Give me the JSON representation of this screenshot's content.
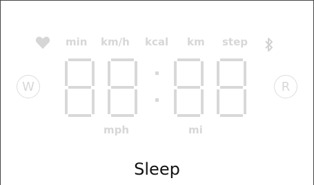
{
  "indicators": {
    "units_top": [
      "min",
      "km/h",
      "kcal",
      "km",
      "step"
    ],
    "units_bottom": [
      "mph",
      "mi"
    ],
    "left_button_label": "W",
    "right_button_label": "R"
  },
  "display": {
    "time_text": "88:88"
  },
  "status_label": "Sleep",
  "colors": {
    "inactive_segment": "#d8d8d8",
    "text": "#111111"
  }
}
